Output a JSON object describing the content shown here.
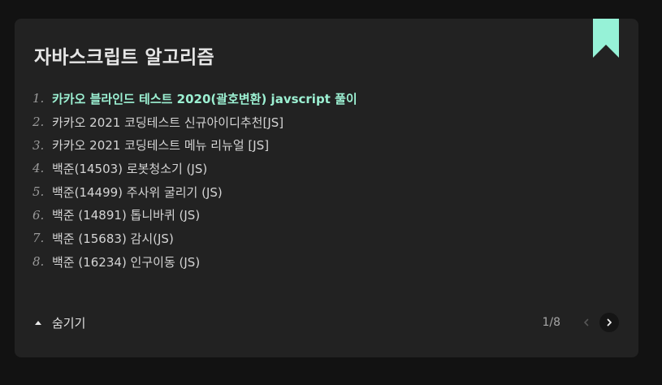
{
  "series": {
    "title": "자바스크립트 알고리즘",
    "posts": [
      {
        "num": "1.",
        "title": "카카오 블라인드 테스트 2020(괄호변환) javscript 풀이",
        "active": true
      },
      {
        "num": "2.",
        "title": "카카오 2021 코딩테스트 신규아이디추천[JS]",
        "active": false
      },
      {
        "num": "3.",
        "title": "카카오 2021 코딩테스트 메뉴 리뉴얼 [JS]",
        "active": false
      },
      {
        "num": "4.",
        "title": "백준(14503) 로봇청소기 (JS)",
        "active": false
      },
      {
        "num": "5.",
        "title": "백준(14499) 주사위 굴리기 (JS)",
        "active": false
      },
      {
        "num": "6.",
        "title": "백준 (14891) 톱니바퀴 (JS)",
        "active": false
      },
      {
        "num": "7.",
        "title": "백준 (15683) 감시(JS)",
        "active": false
      },
      {
        "num": "8.",
        "title": "백준 (16234) 인구이동 (JS)",
        "active": false
      }
    ],
    "toggle_label": "숨기기",
    "page_indicator": "1/8",
    "icons": {
      "bookmark": "bookmark-icon",
      "toggle": "caret-up-icon",
      "prev": "chevron-left-icon",
      "next": "chevron-right-icon"
    }
  },
  "colors": {
    "background": "#121212",
    "card": "#222222",
    "accent": "#96f2d7",
    "text": "#d4d4d4"
  }
}
